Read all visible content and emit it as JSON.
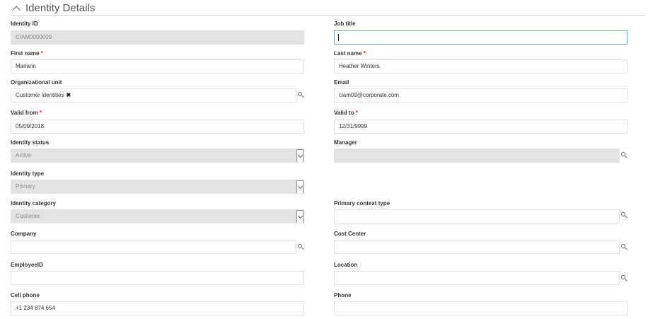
{
  "section": {
    "title": "Identity Details"
  },
  "fields": {
    "identity_id": {
      "label": "Identity ID",
      "value": "CIAM0000009"
    },
    "job_title": {
      "label": "Job title",
      "value": ""
    },
    "first_name": {
      "label": "First name",
      "required": "*",
      "value": "Mariann"
    },
    "last_name": {
      "label": "Last name",
      "required": "*",
      "value": "Heather Winters"
    },
    "org_unit": {
      "label": "Organizational unit",
      "value": "Customer identities",
      "remove": "✖"
    },
    "email": {
      "label": "Email",
      "value": "ciam09@corporate.com"
    },
    "valid_from": {
      "label": "Valid from",
      "required": "*",
      "value": "05/09/2018"
    },
    "valid_to": {
      "label": "Valid to",
      "required": "*",
      "value": "12/31/9999"
    },
    "identity_status": {
      "label": "Identity status",
      "value": "Active"
    },
    "manager": {
      "label": "Manager",
      "value": ""
    },
    "identity_type": {
      "label": "Identity type",
      "value": "Primary"
    },
    "identity_category": {
      "label": "Identity category",
      "value": "Customer"
    },
    "primary_context_type": {
      "label": "Primary context type",
      "value": ""
    },
    "company": {
      "label": "Company",
      "value": ""
    },
    "cost_center": {
      "label": "Cost Center",
      "value": ""
    },
    "employee_id": {
      "label": "EmployeeID",
      "value": ""
    },
    "location": {
      "label": "Location",
      "value": ""
    },
    "cell_phone": {
      "label": "Cell phone",
      "value": "+1 234 874 654"
    },
    "phone": {
      "label": "Phone",
      "value": ""
    }
  },
  "colors": {
    "required": "#e3262d",
    "readonly_bg": "#e3e3e3",
    "focus_border": "#73a6d0"
  }
}
